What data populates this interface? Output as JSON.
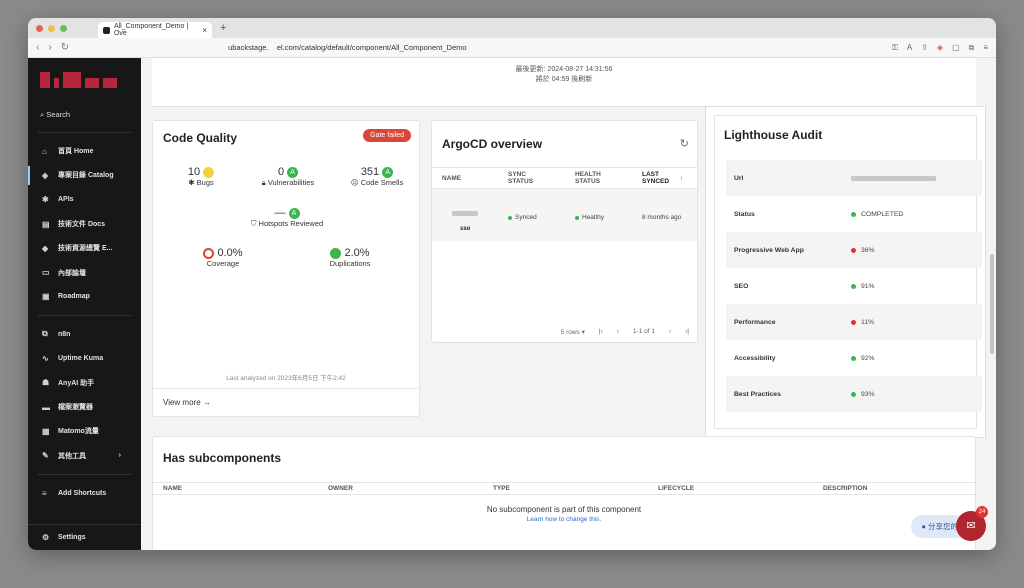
{
  "browser": {
    "tab_title": "All_Component_Demo | Ove",
    "url": "ubackstage.    el.com/catalog/default/component/All_Component_Demo"
  },
  "sidebar": {
    "search_label": "Search",
    "items": [
      {
        "icon": "home-icon",
        "glyph": "⌂",
        "label": "首頁 Home"
      },
      {
        "icon": "catalog-icon",
        "glyph": "◈",
        "label": "專案目錄 Catalog"
      },
      {
        "icon": "api-icon",
        "glyph": "✱",
        "label": "APIs"
      },
      {
        "icon": "docs-icon",
        "glyph": "▤",
        "label": "技術文件 Docs"
      },
      {
        "icon": "layers-icon",
        "glyph": "◆",
        "label": "技術資源總覽 E..."
      },
      {
        "icon": "forum-icon",
        "glyph": "▭",
        "label": "內部論壇"
      },
      {
        "icon": "roadmap-icon",
        "glyph": "▣",
        "label": "Roadmap"
      },
      {
        "icon": "n8n-icon",
        "glyph": "⧉",
        "label": "n8n"
      },
      {
        "icon": "uptime-icon",
        "glyph": "∿",
        "label": "Uptime Kuma"
      },
      {
        "icon": "bot-icon",
        "glyph": "☗",
        "label": "AnyAI 助手"
      },
      {
        "icon": "folder-icon",
        "glyph": "▬",
        "label": "檔案瀏覽器"
      },
      {
        "icon": "matomo-icon",
        "glyph": "▦",
        "label": "Matomo流量"
      },
      {
        "icon": "wrench-icon",
        "glyph": "✎",
        "label": "其他工具",
        "arrow": "›"
      },
      {
        "icon": "shortcuts-icon",
        "glyph": "≡",
        "label": "Add Shortcuts"
      }
    ],
    "settings_label": "Settings"
  },
  "topcard": {
    "line1": "最後更新: 2024-08-27 14:31:56",
    "line2": "將於 04:59 後刷新"
  },
  "code_quality": {
    "title": "Code Quality",
    "gate": "Gate failed",
    "bugs_value": "10",
    "bugs_label": "Bugs",
    "vuln_value": "0",
    "vuln_label": "Vulnerabilities",
    "smells_value": "351",
    "smells_label": "Code Smells",
    "hotspots_value": "—",
    "hotspots_label": "Hotspots Reviewed",
    "coverage_value": "0.0%",
    "coverage_label": "Coverage",
    "dup_value": "2.0%",
    "dup_label": "Duplications",
    "grade_a": "A",
    "analyzed": "Last analyzed on 2023年6月5日 下午2:42",
    "view_more": "View more"
  },
  "argocd": {
    "title": "ArgoCD overview",
    "headers": [
      "NAME",
      "SYNC STATUS",
      "HEALTH STATUS",
      "LAST SYNCED"
    ],
    "row": {
      "name": "sso",
      "sync": "Synced",
      "health": "Healthy",
      "last": "8 months ago"
    },
    "rows_per_page": "5 rows",
    "range": "1-1 of 1"
  },
  "lighthouse": {
    "title": "Lighthouse Audit",
    "rows": [
      {
        "key": "Url",
        "value": "",
        "status": "blurred"
      },
      {
        "key": "Status",
        "value": "COMPLETED",
        "status": "green"
      },
      {
        "key": "Progressive Web App",
        "value": "36%",
        "status": "red"
      },
      {
        "key": "SEO",
        "value": "91%",
        "status": "green"
      },
      {
        "key": "Performance",
        "value": "11%",
        "status": "red"
      },
      {
        "key": "Accessibility",
        "value": "92%",
        "status": "green"
      },
      {
        "key": "Best Practices",
        "value": "93%",
        "status": "green"
      }
    ]
  },
  "subcomponents": {
    "title": "Has subcomponents",
    "headers": [
      "NAME",
      "OWNER",
      "TYPE",
      "LIFECYCLE",
      "DESCRIPTION"
    ],
    "empty": "No subcomponent is part of this component",
    "link": "Learn how to change this."
  },
  "floating": {
    "share": "分享您的",
    "badge": "24"
  }
}
